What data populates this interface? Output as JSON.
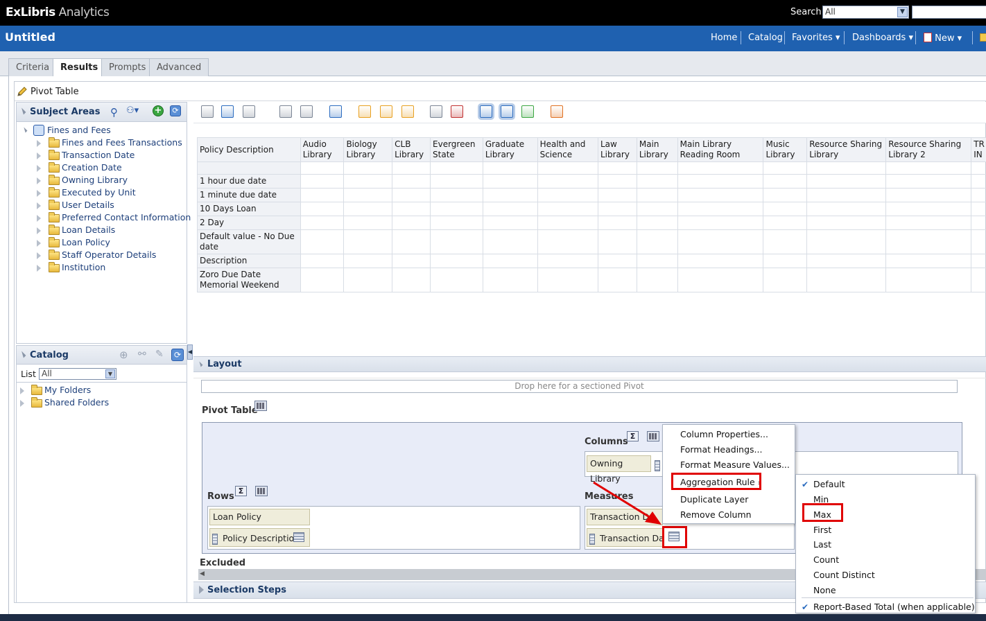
{
  "app": {
    "logo_prefix": "ExLibris",
    "logo_suffix": " Analytics",
    "search_label": "Search",
    "search_scope": "All",
    "title": "Untitled"
  },
  "nav": [
    "Home",
    "Catalog",
    "Favorites",
    "Dashboards",
    "New"
  ],
  "tabs": [
    "Criteria",
    "Results",
    "Prompts",
    "Advanced"
  ],
  "editor": {
    "title": "Pivot Table"
  },
  "subject_areas": {
    "title": "Subject Areas",
    "root": "Fines and Fees",
    "folders": [
      "Fines and Fees Transactions",
      "Transaction Date",
      "Creation Date",
      "Owning Library",
      "Executed by Unit",
      "User Details",
      "Preferred Contact Information",
      "Loan Details",
      "Loan Policy",
      "Staff Operator Details",
      "Institution"
    ]
  },
  "catalog": {
    "title": "Catalog",
    "list_label": "List",
    "list_value": "All",
    "folders": [
      "My Folders",
      "Shared Folders"
    ]
  },
  "pivot": {
    "corner": "Policy Description",
    "columns": [
      "Audio Library",
      "Biology Library",
      "CLB Library",
      "Evergreen State",
      "Graduate Library",
      "Health and Science",
      "Law Library",
      "Main Library",
      "Main Library Reading Room",
      "Music Library",
      "Resource Sharing Library",
      "Resource Sharing Library 2",
      "TR IN"
    ],
    "rows": [
      "1 hour due date",
      "1 minute due date",
      "10 Days Loan",
      "2 Day",
      "Default value - No Due date",
      "Description",
      "Zoro Due Date Memorial Weekend"
    ]
  },
  "layout": {
    "title": "Layout",
    "sections_drop": "Drop here for a sectioned Pivot",
    "pivot_label": "Pivot Table",
    "columns_label": "Columns",
    "rows_label": "Rows",
    "measures_label": "Measures",
    "column_chip": "Owning Library",
    "row_chips": [
      "Loan Policy",
      "Policy Description"
    ],
    "measure_chips": [
      "Transaction Da",
      "Transaction Date"
    ],
    "excluded_label": "Excluded",
    "selection_steps": "Selection Steps"
  },
  "context_menu": [
    "Column Properties...",
    "Format Headings...",
    "Format Measure Values...",
    "Aggregation Rule",
    "Duplicate Layer",
    "Remove Column"
  ],
  "aggregation_menu": {
    "items": [
      "Default",
      "Min",
      "Max",
      "First",
      "Last",
      "Count",
      "Count Distinct",
      "None"
    ],
    "checked": "Default",
    "footer": "Report-Based Total (when applicable)"
  },
  "colors": {
    "header_blue": "#1f61b0",
    "highlight_red": "#e00000"
  }
}
